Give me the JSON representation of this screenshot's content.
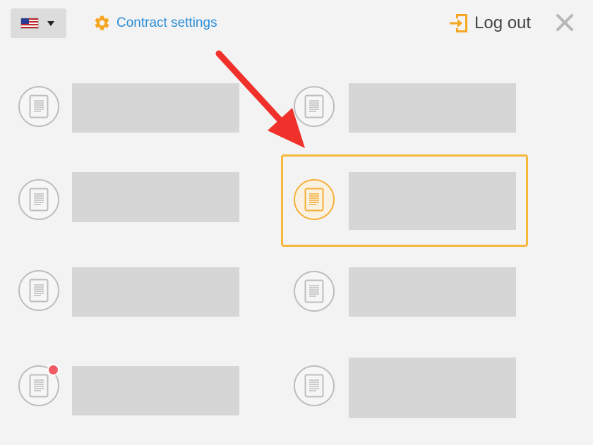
{
  "header": {
    "language": {
      "flag": "us-flag-icon",
      "dropdown_icon": "caret-down-icon"
    },
    "contract_settings": {
      "label": "Contract settings",
      "icon": "gear-icon",
      "color": "#2b8ed8"
    },
    "logout": {
      "label": "Log out",
      "icon": "logout-icon",
      "color": "#f5a623"
    },
    "close": {
      "icon": "close-icon"
    }
  },
  "grid": {
    "items": [
      {
        "label": "",
        "icon": "document-icon",
        "state": "default"
      },
      {
        "label": "",
        "icon": "document-icon",
        "state": "default"
      },
      {
        "label": "",
        "icon": "document-icon",
        "state": "default"
      },
      {
        "label": "",
        "icon": "document-icon",
        "state": "selected"
      },
      {
        "label": "",
        "icon": "document-icon",
        "state": "default"
      },
      {
        "label": "",
        "icon": "document-icon",
        "state": "default"
      },
      {
        "label": "",
        "icon": "document-icon",
        "state": "default",
        "notification": true
      },
      {
        "label": "",
        "icon": "document-icon",
        "state": "default"
      }
    ]
  },
  "annotations": {
    "arrow_color": "#f0302a",
    "highlight_color": "#f5b83a"
  },
  "colors": {
    "background": "#f3f3f3",
    "placeholder": "#d6d6d6",
    "icon_gray": "#bdbdbd",
    "active": "#f5b038",
    "badge": "#f05c63"
  }
}
